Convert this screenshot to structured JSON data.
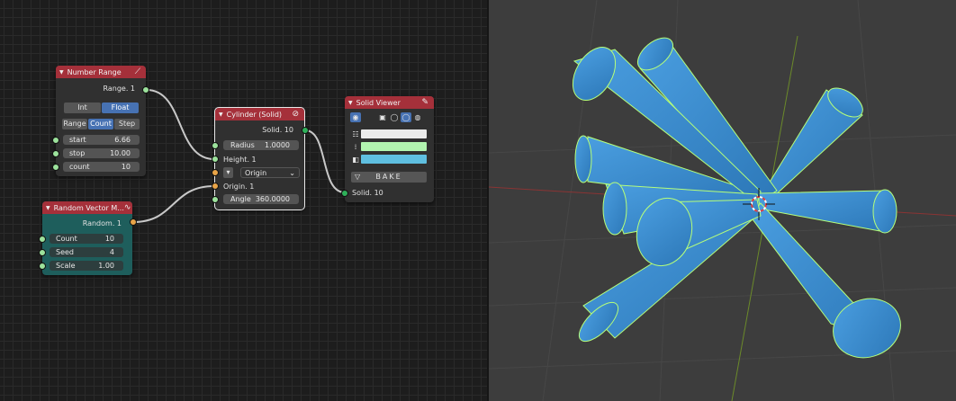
{
  "colors": {
    "node_header_red": "#a5303a",
    "node_body": "#303030",
    "node_body_teal": "#1e5e5c",
    "socket_green": "#9ce29c",
    "socket_orange": "#e8a448",
    "socket_solid": "#2fb05a",
    "active_button": "#4772b3",
    "viewport_bg": "#3d3d3d",
    "cylinder_blue": "#3a8ccc",
    "selection_outline": "#b6ff7a"
  },
  "number_range": {
    "title": "Number Range",
    "header_icon": "pencil-icon",
    "output_label": "Range. 1",
    "mode_buttons": [
      {
        "label": "Int",
        "active": false
      },
      {
        "label": "Float",
        "active": true
      }
    ],
    "type_buttons": [
      {
        "label": "Range",
        "active": false
      },
      {
        "label": "Count",
        "active": true
      },
      {
        "label": "Step",
        "active": false
      }
    ],
    "start": {
      "label": "start",
      "value": "6.66"
    },
    "stop": {
      "label": "stop",
      "value": "10.00"
    },
    "count": {
      "label": "count",
      "value": "10"
    }
  },
  "random_vector": {
    "title": "Random Vector M...",
    "header_icon": "wave-icon",
    "output_label": "Random. 1",
    "count": {
      "label": "Count",
      "value": "10"
    },
    "seed": {
      "label": "Seed",
      "value": "4"
    },
    "scale": {
      "label": "Scale",
      "value": "1.00"
    }
  },
  "cylinder": {
    "title": "Cylinder (Solid)",
    "header_icon": "link-icon",
    "output_label": "Solid. 10",
    "radius": {
      "label": "Radius",
      "value": "1.0000"
    },
    "height_label": "Height. 1",
    "origin_mode": "Origin",
    "origin_label": "Origin. 1",
    "angle": {
      "label": "Angle",
      "value": "360.0000"
    }
  },
  "solid_viewer": {
    "title": "Solid Viewer",
    "header_icon": "pencil-icon",
    "toolbar_icons": [
      "eye-icon",
      "cube-icon",
      "wireframe-sphere-icon",
      "solid-sphere-icon",
      "material-sphere-icon"
    ],
    "swatch_colors": [
      "#ebebeb",
      "#b2f5b0",
      "#5fbfe0"
    ],
    "swatch_icons": [
      "vertices-icon",
      "edges-icon",
      "faces-icon"
    ],
    "bake_label": "BAKE",
    "input_label": "Solid. 10"
  }
}
